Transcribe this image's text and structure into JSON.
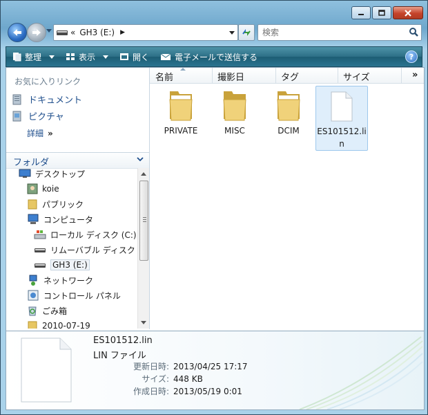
{
  "window": {
    "colors": {
      "frame": "#7fb3d6",
      "command_bar": "#2c6f86",
      "selection": "#dfeefb"
    }
  },
  "nav": {
    "address_chevron": "«",
    "address_crumb": "GH3 (E:)",
    "search_placeholder": "検索"
  },
  "toolbar": {
    "organize": "整理",
    "views": "表示",
    "open": "開く",
    "email": "電子メールで送信する",
    "help": "?"
  },
  "favorites": {
    "title": "お気に入りリンク",
    "items": [
      {
        "label": "ドキュメント",
        "icon": "documents-icon"
      },
      {
        "label": "ピクチャ",
        "icon": "pictures-icon"
      }
    ],
    "more_label": "詳細",
    "more_arrows": "»"
  },
  "folders": {
    "header": "フォルダ",
    "tree": [
      {
        "label": "デスクトップ",
        "icon": "desktop-icon"
      },
      {
        "label": "koie",
        "icon": "user-folder-icon"
      },
      {
        "label": "パブリック",
        "icon": "folder-icon"
      },
      {
        "label": "コンピュータ",
        "icon": "computer-icon"
      },
      {
        "label": "ローカル ディスク (C:)",
        "icon": "local-disk-icon"
      },
      {
        "label": "リムーバブル ディスク",
        "icon": "removable-drive-icon"
      },
      {
        "label": "GH3 (E:)",
        "icon": "removable-drive-icon"
      },
      {
        "label": "ネットワーク",
        "icon": "network-icon"
      },
      {
        "label": "コントロール パネル",
        "icon": "control-panel-icon"
      },
      {
        "label": "ごみ箱",
        "icon": "recycle-bin-icon"
      },
      {
        "label": "2010-07-19",
        "icon": "folder-icon"
      }
    ]
  },
  "columns": [
    "名前",
    "撮影日",
    "タグ",
    "サイズ",
    "»"
  ],
  "files": [
    {
      "label": "PRIVATE",
      "type": "folder"
    },
    {
      "label": "MISC",
      "type": "folder"
    },
    {
      "label": "DCIM",
      "type": "folder"
    },
    {
      "label": "ES101512.lin",
      "type": "file"
    }
  ],
  "details": {
    "name": "ES101512.lin",
    "type": "LIN ファイル",
    "rows": [
      {
        "key": "更新日時:",
        "value": "2013/04/25 17:17"
      },
      {
        "key": "サイズ:",
        "value": "448 KB"
      },
      {
        "key": "作成日時:",
        "value": "2013/05/19 0:01"
      }
    ]
  }
}
